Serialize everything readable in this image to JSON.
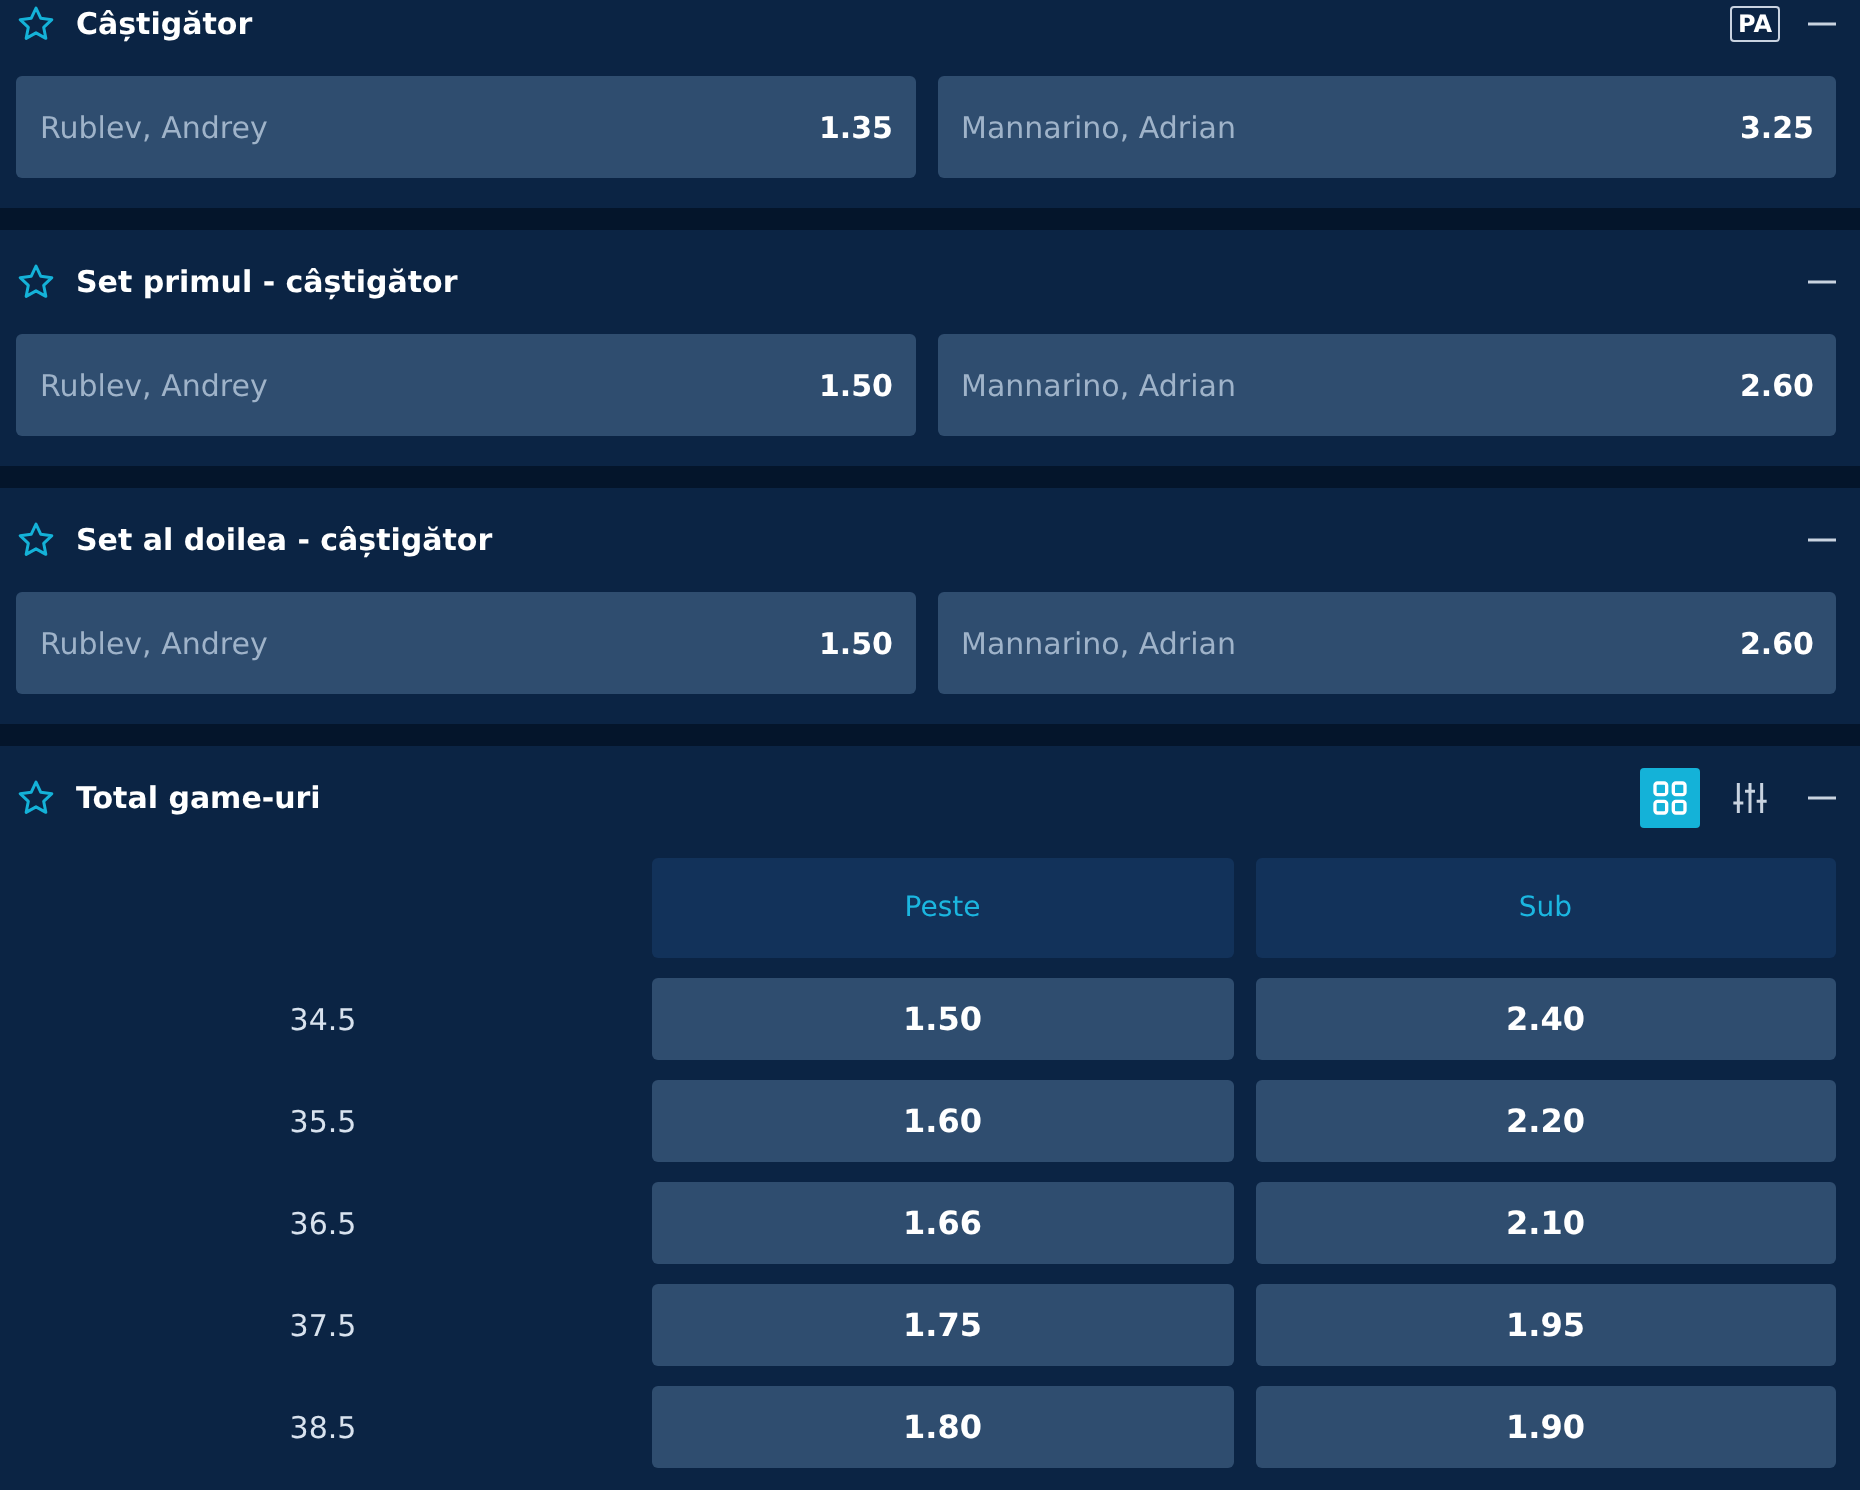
{
  "markets": [
    {
      "kind": "pair",
      "title": "Câștigător",
      "badge": "PA",
      "favorite": false,
      "outcomes": [
        {
          "name": "Rublev, Andrey",
          "odds": "1.35"
        },
        {
          "name": "Mannarino, Adrian",
          "odds": "3.25"
        }
      ]
    },
    {
      "kind": "pair",
      "title": "Set primul - câștigător",
      "favorite": false,
      "outcomes": [
        {
          "name": "Rublev, Andrey",
          "odds": "1.50"
        },
        {
          "name": "Mannarino, Adrian",
          "odds": "2.60"
        }
      ]
    },
    {
      "kind": "pair",
      "title": "Set al doilea - câștigător",
      "favorite": false,
      "outcomes": [
        {
          "name": "Rublev, Andrey",
          "odds": "1.50"
        },
        {
          "name": "Mannarino, Adrian",
          "odds": "2.60"
        }
      ]
    },
    {
      "kind": "table",
      "title": "Total game-uri",
      "favorite": false,
      "view_toggle": [
        {
          "kind": "grid",
          "selected": true
        },
        {
          "kind": "sliders",
          "selected": false
        }
      ],
      "columns": [
        "Peste",
        "Sub"
      ],
      "rows": [
        {
          "line": "34.5",
          "odds": [
            "1.50",
            "2.40"
          ]
        },
        {
          "line": "35.5",
          "odds": [
            "1.60",
            "2.20"
          ]
        },
        {
          "line": "36.5",
          "odds": [
            "1.66",
            "2.10"
          ]
        },
        {
          "line": "37.5",
          "odds": [
            "1.75",
            "1.95"
          ]
        },
        {
          "line": "38.5",
          "odds": [
            "1.80",
            "1.90"
          ]
        }
      ]
    }
  ]
}
